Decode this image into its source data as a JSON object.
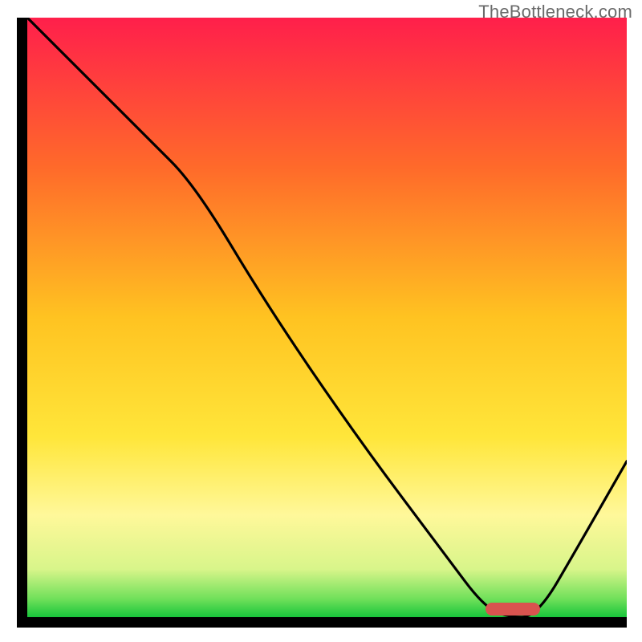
{
  "watermark": "TheBottleneck.com",
  "chart_data": {
    "type": "line",
    "title": "",
    "xlabel": "",
    "ylabel": "",
    "xlim": [
      0,
      100
    ],
    "ylim": [
      0,
      100
    ],
    "grid": false,
    "legend": false,
    "note": "Curve shows bottleneck severity vs. some parameter; minimum (green zone) near x≈78–85. Background vertical gradient: red→orange→yellow→green bottom band.",
    "gradient_stops": [
      {
        "pct": 0,
        "color": "#ff1f4b"
      },
      {
        "pct": 25,
        "color": "#ff6a2a"
      },
      {
        "pct": 50,
        "color": "#ffc321"
      },
      {
        "pct": 70,
        "color": "#ffe63a"
      },
      {
        "pct": 83,
        "color": "#fff89a"
      },
      {
        "pct": 92,
        "color": "#d8f58a"
      },
      {
        "pct": 97,
        "color": "#6fe05a"
      },
      {
        "pct": 100,
        "color": "#18c53b"
      }
    ],
    "series": [
      {
        "name": "bottleneck-curve",
        "x": [
          0,
          10,
          20,
          28,
          40,
          55,
          70,
          76,
          80,
          85,
          92,
          100
        ],
        "y": [
          100,
          90,
          80,
          72,
          52,
          30,
          10,
          2,
          0,
          0,
          12,
          26
        ]
      }
    ],
    "marker": {
      "x_center": 81,
      "y": 1.3,
      "width_pct": 9
    }
  }
}
